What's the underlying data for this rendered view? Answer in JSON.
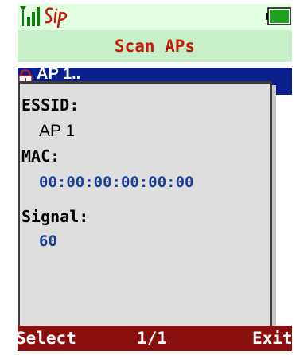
{
  "status": {
    "signal_icon": "signal-strength-icon",
    "sip_logo": "Sip",
    "battery_icon": "battery-full-icon"
  },
  "title": "Scan APs",
  "list": {
    "selected_item": "AP 1..",
    "lock_icon": "lock-icon"
  },
  "details": {
    "essid_label": "ESSID:",
    "essid_value": "AP 1",
    "mac_label": "MAC:",
    "mac_value": "00:00:00:00:00:00",
    "signal_label": "Signal:",
    "signal_value": "60"
  },
  "softkeys": {
    "left": "Select",
    "center": "1/1",
    "right": "Exit"
  },
  "colors": {
    "status_bg": "#e2ffe2",
    "title_bg": "#c8f0c8",
    "title_text": "#c41a0a",
    "selection_bg": "#0a1e8c",
    "softkey_bg": "#8a1010",
    "value_blue": "#1c3f94"
  }
}
